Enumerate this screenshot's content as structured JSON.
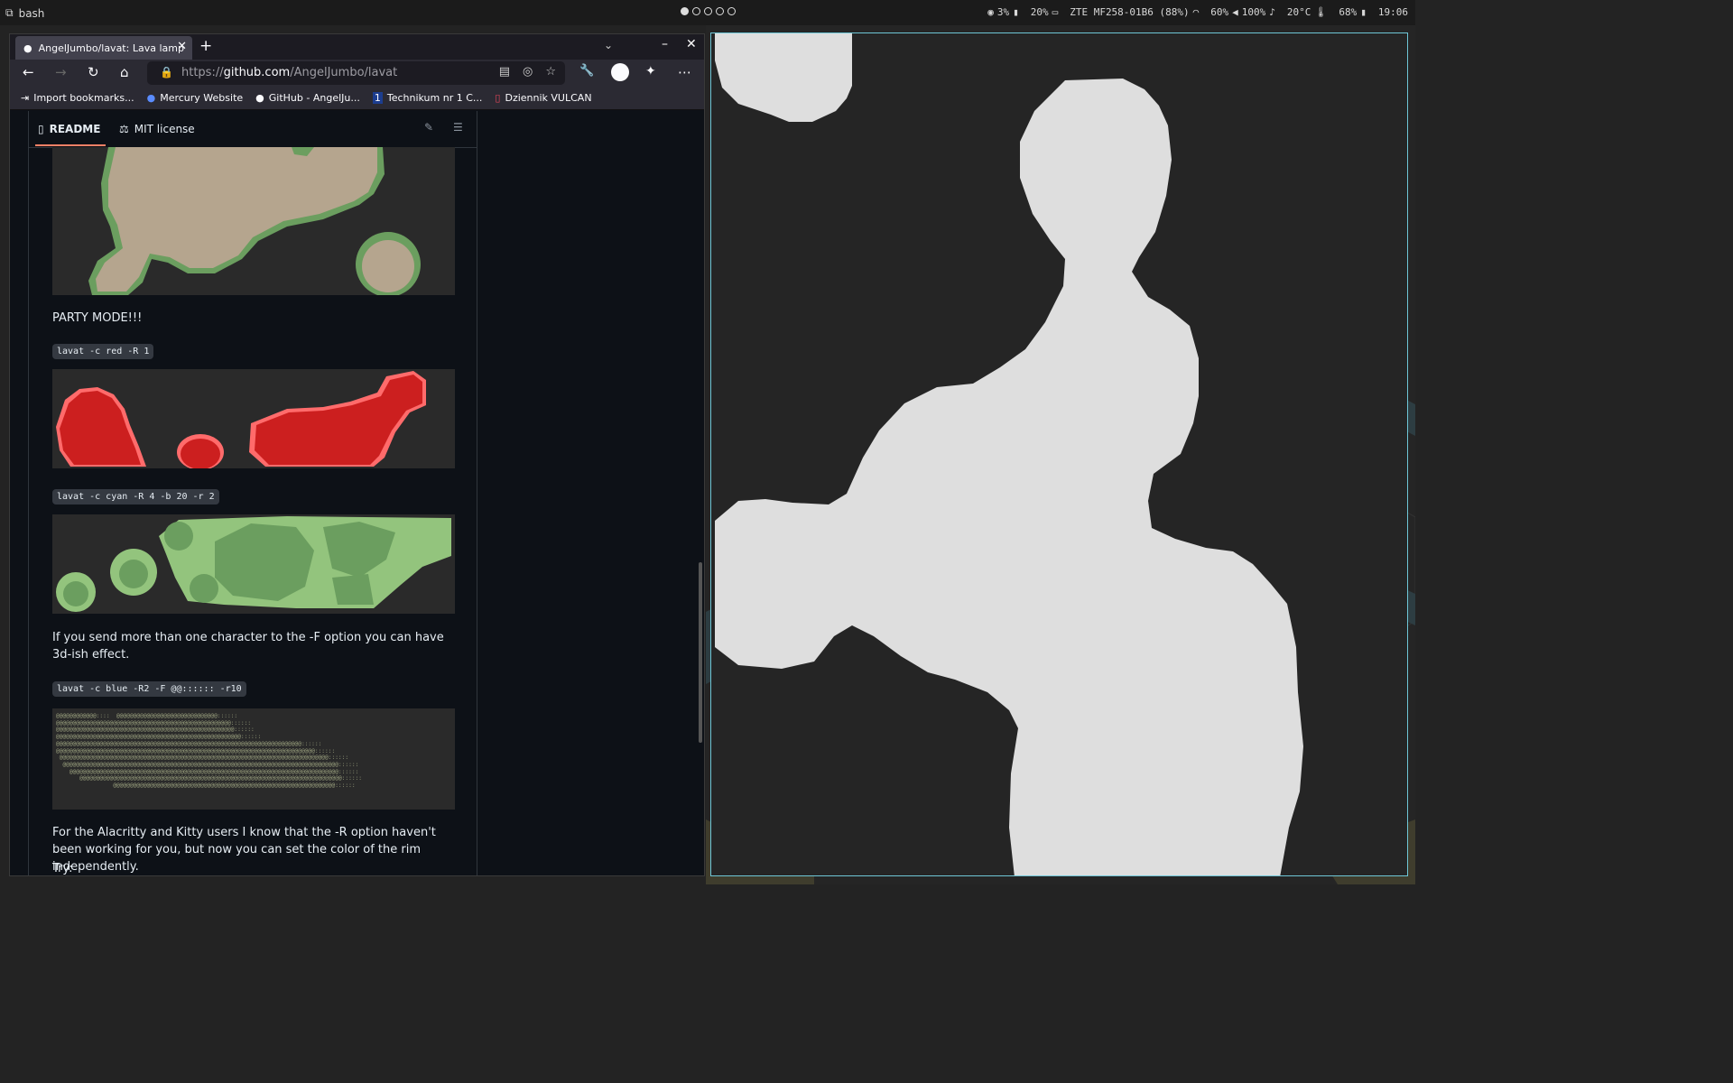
{
  "topbar": {
    "app": "bash",
    "status": [
      "3%",
      "20%",
      "ZTE MF258-01B6 (88%)",
      "60%",
      "100%",
      "20°C",
      "68%",
      "19:06"
    ]
  },
  "browser": {
    "tab_title": "AngelJumbo/lavat: Lava lamp",
    "url_prefix": "https://",
    "url_host": "github.com",
    "url_path": "/AngelJumbo/lavat",
    "bookmarks": [
      "Import bookmarks...",
      "Mercury Website",
      "GitHub - AngelJu...",
      "Technikum nr 1 C...",
      "Dziennik VULCAN"
    ]
  },
  "readme": {
    "tab_readme": "README",
    "tab_license": "MIT license",
    "party": "PARTY MODE!!!",
    "code1": "lavat -c red -R 1",
    "code2": "lavat -c cyan -R 4 -b 20 -r 2",
    "para3d": "If you send more than one character to the -F option you can have 3d-ish effect.",
    "code3": "lavat -c blue -R2 -F @@:::::: -r10",
    "ascii": "@@@@@@@@@@@@::::  @@@@@@@@@@@@@@@@@@@@@@@@@@@@@@::::::\n@@@@@@@@@@@@@@@@@@@@@@@@@@@@@@@@@@@@@@@@@@@@@@@@@@@@::::::\n@@@@@@@@@@@@@@@@@@@@@@@@@@@@@@@@@@@@@@@@@@@@@@@@@@@@@::::::\n@@@@@@@@@@@@@@@@@@@@@@@@@@@@@@@@@@@@@@@@@@@@@@@@@@@@@@@::::::\n@@@@@@@@@@@@@@@@@@@@@@@@@@@@@@@@@@@@@@@@@@@@@@@@@@@@@@@@@@@@@@@@@@@@@@@@@::::::\n@@@@@@@@@@@@@@@@@@@@@@@@@@@@@@@@@@@@@@@@@@@@@@@@@@@@@@@@@@@@@@@@@@@@@@@@@@@@@::::::\n @@@@@@@@@@@@@@@@@@@@@@@@@@@@@@@@@@@@@@@@@@@@@@@@@@@@@@@@@@@@@@@@@@@@@@@@@@@@@@@@::::::\n  @@@@@@@@@@@@@@@@@@@@@@@@@@@@@@@@@@@@@@@@@@@@@@@@@@@@@@@@@@@@@@@@@@@@@@@@@@@@@@@@@@::::::\n    @@@@@@@@@@@@@@@@@@@@@@@@@@@@@@@@@@@@@@@@@@@@@@@@@@@@@@@@@@@@@@@@@@@@@@@@@@@@@@@@::::::\n       @@@@@@@@@@@@@@@@@@@@@@@@@@@@@@@@@@@@@@@@@@@@@@@@@@@@@@@@@@@@@@@@@@@@@@@@@@@@@@::::::\n                 @@@@@@@@@@@@@@@@@@@@@@@@@@@@@@@@@@@@@@@@@@@@@@@@@@@@@@@@@@@@@@@@@@::::::",
    "para_kitty": "For the Alacritty and Kitty users I know that the -R option haven't been working for you, but now you can set the color of the rim independently.",
    "try": "Try:"
  },
  "colors": {
    "accent_border": "#6ec6d6",
    "lava_blob": "#dedede",
    "red_fill": "#cc1f1f",
    "red_rim": "#ff6b6b",
    "green_fill": "#6b9e5f",
    "green_rim": "#93c47d",
    "tan_fill": "#b5a58e"
  }
}
